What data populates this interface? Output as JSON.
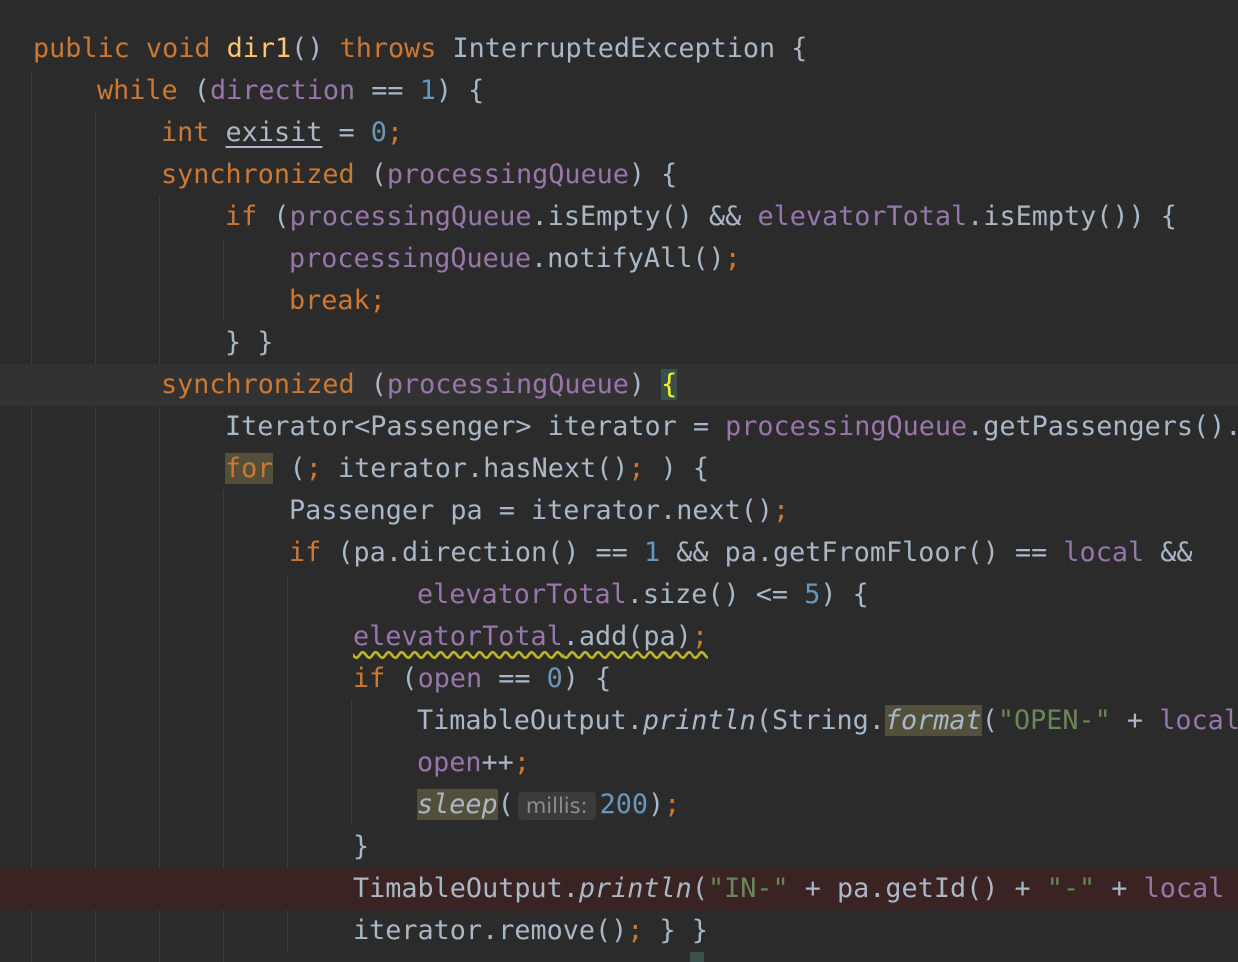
{
  "editor": {
    "lines": [
      {
        "t1": "public void ",
        "t2": "dir1",
        "t3": "() ",
        "t4": "throws",
        "t5": " InterruptedException {"
      },
      {
        "t1": "while",
        "t2": " (",
        "t3": "direction",
        "t4": " == ",
        "t5": "1",
        "t6": ") {"
      },
      {
        "t1": "int",
        "t2": " ",
        "t3": "exisit",
        "t4": " = ",
        "t5": "0",
        "t6": ";"
      },
      {
        "t1": "synchronized",
        "t2": " (",
        "t3": "processingQueue",
        "t4": ") {"
      },
      {
        "t1": "if",
        "t2": " (",
        "t3": "processingQueue",
        "t4": ".isEmpty() && ",
        "t5": "elevatorTotal",
        "t6": ".isEmpty()) {"
      },
      {
        "t1": "processingQueue",
        "t2": ".notifyAll()",
        "t3": ";"
      },
      {
        "t1": "break;"
      },
      {
        "t1": "} }"
      },
      {
        "t1": "synchronized",
        "t2": " (",
        "t3": "processingQueue",
        "t4": ") ",
        "t5": "{"
      },
      {
        "t1": "Iterator<Passenger> iterator = ",
        "t2": "processingQueue",
        "t3": ".getPassengers().i"
      },
      {
        "t1": "for",
        "t2": " (",
        "t3": "; ",
        "t4": "iterator.hasNext()",
        "t5": "; ",
        "t6": ") {"
      },
      {
        "t1": "Passenger pa = iterator.next()",
        "t2": ";"
      },
      {
        "t1": "if",
        "t2": " (pa.direction() == ",
        "t3": "1",
        "t4": " && pa.getFromFloor() == ",
        "t5": "local",
        "t6": " &&"
      },
      {
        "t1": "elevatorTotal",
        "t2": ".size() <= ",
        "t3": "5",
        "t4": ") {"
      },
      {
        "t1": "elevatorTotal",
        "t2": ".add(pa)",
        "t3": ";"
      },
      {
        "t1": "if",
        "t2": " (",
        "t3": "open",
        "t4": " == ",
        "t5": "0",
        "t6": ") {"
      },
      {
        "t1": "TimableOutput.",
        "t2": "println",
        "t3": "(String.",
        "t4": "format",
        "t5": "(",
        "t6": "\"OPEN-\"",
        "t7": " + ",
        "t8": "local"
      },
      {
        "t1": "open",
        "t2": "++",
        "t3": ";"
      },
      {
        "t1": "sleep",
        "t2": "(",
        "hint": "millis:",
        "t3": "200",
        "t4": ")",
        "t5": ";"
      },
      {
        "t1": "}"
      },
      {
        "t1": "TimableOutput.",
        "t2": "println",
        "t3": "(",
        "t4": "\"IN-\"",
        "t5": " + pa.getId() + ",
        "t6": "\"-\"",
        "t7": " + ",
        "t8": "local",
        "t9": " +"
      },
      {
        "t1": "iterator.remove()",
        "t2": "; ",
        "t3": "} }"
      }
    ]
  },
  "colors": {
    "background": "#2b2b2b",
    "keyword": "#cc7832",
    "field": "#9876aa",
    "number": "#6897bb",
    "string": "#6a8759",
    "method_decl": "#ffc66d",
    "default_text": "#a9b7c6",
    "breakpoint_line": "#3a2323",
    "caret_line": "#323232"
  }
}
